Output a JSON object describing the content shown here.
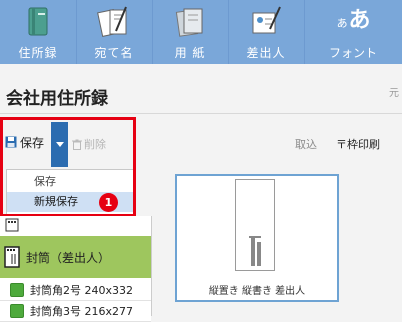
{
  "ribbon": {
    "tabs": [
      {
        "label": "住所録",
        "icon": "address-book-icon"
      },
      {
        "label": "宛て名",
        "icon": "postcard-pen-icon"
      },
      {
        "label": "用 紙",
        "icon": "paper-icon"
      },
      {
        "label": "差出人",
        "icon": "sender-card-icon"
      },
      {
        "label": "フォント",
        "icon": "font-aa-icon",
        "glyph_small": "ぁ",
        "glyph_big": "あ"
      }
    ]
  },
  "header": {
    "title": "会社用住所録",
    "corner_text": "元"
  },
  "toolbar": {
    "save_label": "保存",
    "delete_label": "削除",
    "import_label": "取込",
    "frame_print_label": "〒枠印刷"
  },
  "menu": {
    "items": [
      "保存",
      "新規保存"
    ],
    "highlighted_index": 1
  },
  "annotation": {
    "badge": "1"
  },
  "list": {
    "group_label": "封筒（差出人）",
    "items": [
      "封筒角2号 240x332",
      "封筒角3号 216x277"
    ]
  },
  "preview": {
    "card_label": "縦置き 縦書き 差出人"
  },
  "colors": {
    "ribbon_bg": "#7aa7d9",
    "accent_blue": "#2b6cb0",
    "highlight": "#e60012",
    "group_green": "#9ec65e",
    "card_border": "#6ea3d3"
  }
}
